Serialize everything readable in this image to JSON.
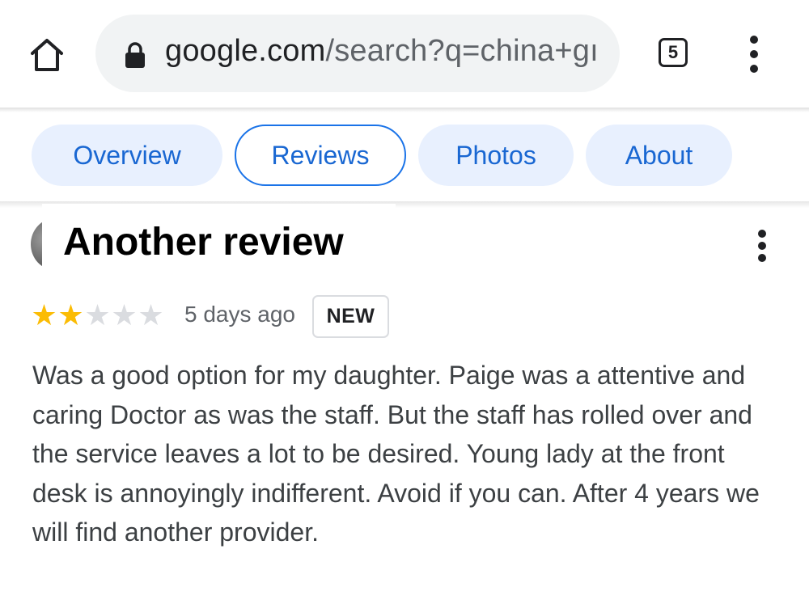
{
  "browser": {
    "url_host": "google.com",
    "url_path": "/search?q=china+gı",
    "tab_count": "5",
    "icons": {
      "home": "home-icon",
      "lock": "lock-icon",
      "menu": "more-vert-icon"
    }
  },
  "tabs": [
    {
      "label": "Overview",
      "active": false
    },
    {
      "label": "Reviews",
      "active": true
    },
    {
      "label": "Photos",
      "active": false
    },
    {
      "label": "About",
      "active": false
    }
  ],
  "review": {
    "title": "Another review",
    "rating": 2,
    "max_rating": 5,
    "date": "5 days ago",
    "badge": "NEW",
    "text": "Was a good option for my daughter. Paige was a attentive and caring Doctor as was the staff. But the staff has rolled over and the service leaves a lot to be desired. Young lady at the front desk is annoyingly indifferent. Avoid if you can. After 4 years we will find another provider."
  },
  "colors": {
    "accent": "#1a73e8",
    "tab_bg": "#e8f0fe",
    "star_filled": "#fbbc04",
    "star_empty": "#dadce0"
  }
}
